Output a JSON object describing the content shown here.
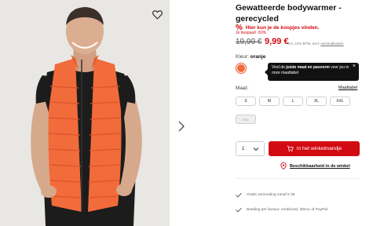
{
  "product": {
    "title": "Gewatteerde bodywarmer - gerecycled",
    "promo_pct": "%",
    "promo_text": "Hier kun je de koopjes vinden.",
    "saved_text": "Je bespaart -50%",
    "old_price": "19,99 €",
    "new_price": "9,99 €",
    "vat_text": "incl. 21% BTW, excl.",
    "shipping_link": "verzendkosten"
  },
  "color": {
    "label": "Kleur:",
    "value": "oranje",
    "swatch_hex": "#f26b3a"
  },
  "tooltip": {
    "prefix": "Vind de ",
    "bold": "juiste maat en pasvorm",
    "suffix": " voor jou in onze maattabel",
    "close": "×"
  },
  "sizes": {
    "label": "Maat:",
    "guide_link": "Maattabel",
    "options": [
      "S",
      "M",
      "L",
      "XL",
      "XXL"
    ],
    "unavailable": "3XL"
  },
  "purchase": {
    "quantity": "1",
    "add_to_cart": "In het winkelmandje",
    "store_availability": "Beschikbaarheid in de winkel"
  },
  "usps": [
    "Gratis verzending vanaf € 39",
    "Betaling per factuur, creditcard, iDEAL of PayPal"
  ],
  "colors": {
    "accent": "#d20a11",
    "vest": "#f26b3a"
  }
}
